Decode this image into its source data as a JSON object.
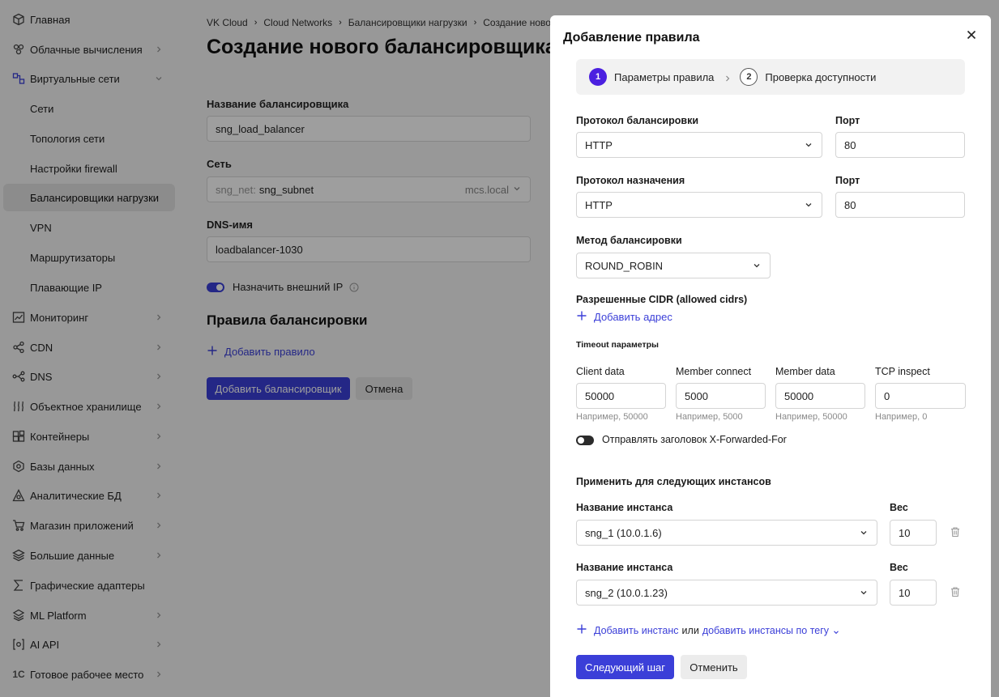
{
  "sidebar": {
    "items": [
      {
        "label": "Главная",
        "icon": "cube-icon"
      },
      {
        "label": "Облачные вычисления",
        "icon": "compute-icon"
      },
      {
        "label": "Виртуальные сети",
        "icon": "network-icon"
      },
      {
        "label": "Сети"
      },
      {
        "label": "Топология сети"
      },
      {
        "label": "Настройки firewall"
      },
      {
        "label": "Балансировщики нагрузки"
      },
      {
        "label": "VPN"
      },
      {
        "label": "Маршрутизаторы"
      },
      {
        "label": "Плавающие IP"
      },
      {
        "label": "Мониторинг",
        "icon": "chart-icon"
      },
      {
        "label": "CDN",
        "icon": "share-icon"
      },
      {
        "label": "DNS",
        "icon": "dns-icon"
      },
      {
        "label": "Объектное хранилище",
        "icon": "storage-icon"
      },
      {
        "label": "Контейнеры",
        "icon": "containers-icon"
      },
      {
        "label": "Базы данных",
        "icon": "database-icon"
      },
      {
        "label": "Аналитические БД",
        "icon": "analytics-icon"
      },
      {
        "label": "Магазин приложений",
        "icon": "cart-icon"
      },
      {
        "label": "Большие данные",
        "icon": "layers-icon"
      },
      {
        "label": "Графические адаптеры",
        "icon": "sigma-icon"
      },
      {
        "label": "ML Platform",
        "icon": "ml-icon"
      },
      {
        "label": "AI API",
        "icon": "ai-icon"
      },
      {
        "label": "Готовое рабочее место",
        "icon": "1c-icon"
      }
    ]
  },
  "breadcrumb": [
    "VK Cloud",
    "Cloud Networks",
    "Балансировщики нагрузки",
    "Создание нового балансировщика"
  ],
  "page": {
    "title": "Создание нового балансировщика",
    "name_label": "Название балансировщика",
    "name_value": "sng_load_balancer",
    "network_label": "Сеть",
    "network_prefix": "sng_net:",
    "network_value": "sng_subnet",
    "network_suffix": "mcs.local",
    "dns_label": "DNS-имя",
    "dns_value": "loadbalancer-1030",
    "external_ip_label": "Назначить внешний IP",
    "rules_title": "Правила балансировки",
    "add_rule": "Добавить правило",
    "add_balancer": "Добавить балансировщик",
    "cancel": "Отмена"
  },
  "modal": {
    "title": "Добавление правила",
    "steps": [
      {
        "num": "1",
        "label": "Параметры правила"
      },
      {
        "num": "2",
        "label": "Проверка доступности"
      }
    ],
    "balance_protocol_label": "Протокол балансировки",
    "balance_protocol_value": "HTTP",
    "port_label": "Порт",
    "port1_value": "80",
    "dest_protocol_label": "Протокол назначения",
    "dest_protocol_value": "HTTP",
    "port2_value": "80",
    "method_label": "Метод балансировки",
    "method_value": "ROUND_ROBIN",
    "cidr_label": "Разрешенные CIDR (allowed cidrs)",
    "add_address": "Добавить адрес",
    "timeout_title": "Timeout параметры",
    "timeouts": [
      {
        "label": "Client data",
        "value": "50000",
        "hint": "Например, 50000"
      },
      {
        "label": "Member connect",
        "value": "5000",
        "hint": "Например, 5000"
      },
      {
        "label": "Member data",
        "value": "50000",
        "hint": "Например, 50000"
      },
      {
        "label": "TCP inspect",
        "value": "0",
        "hint": "Например, 0"
      }
    ],
    "xff_label": "Отправлять заголовок X-Forwarded-For",
    "instances_title": "Применить для следующих инстансов",
    "instance_label": "Название инстанса",
    "weight_label": "Вес",
    "instances": [
      {
        "name": "sng_1 (10.0.1.6)",
        "weight": "10"
      },
      {
        "name": "sng_2 (10.0.1.23)",
        "weight": "10"
      }
    ],
    "add_instance": "Добавить инстанс",
    "or": "или",
    "add_by_tag": "добавить инстансы по тегу",
    "next_button": "Следующий шаг",
    "cancel_button": "Отменить"
  },
  "colors": {
    "accent": "#3b3fd8",
    "step_active": "#4b20e0"
  }
}
